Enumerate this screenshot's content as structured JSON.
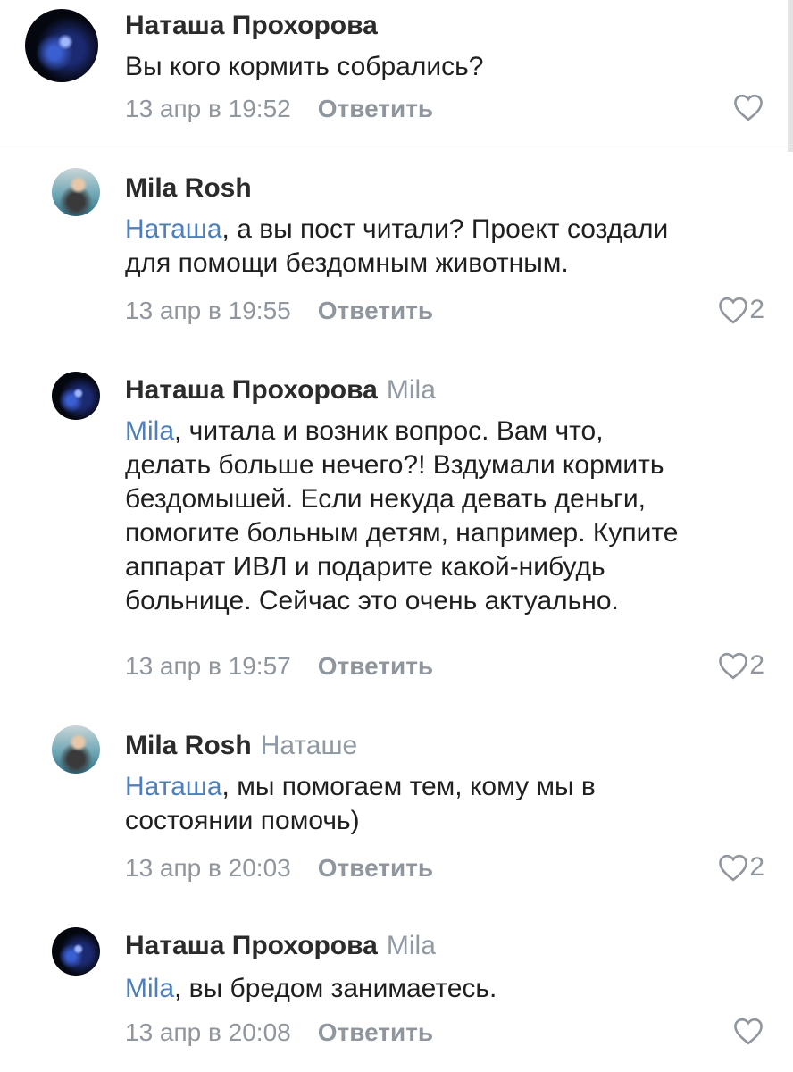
{
  "comments": [
    {
      "author": "Наташа Прохорова",
      "reply_to": "",
      "mention": "",
      "lines": [
        "Вы кого кормить собрались?"
      ],
      "date": "13 апр в 19:52",
      "reply_label": "Ответить",
      "likes": ""
    },
    {
      "author": "Mila Rosh",
      "reply_to": "",
      "mention": "Наташа",
      "lines": [
        ", а вы пост читали? Проект создали",
        "для помощи бездомным животным."
      ],
      "date": "13 апр в 19:55",
      "reply_label": "Ответить",
      "likes": "2"
    },
    {
      "author": "Наташа Прохорова",
      "reply_to": "Mila",
      "mention": "Mila",
      "lines": [
        ", читала и возник вопрос. Вам что,",
        "делать больше нечего?! Вздумали кормить",
        "бездомышей. Если некуда девать деньги,",
        "помогите больным детям, например. Купите",
        "аппарат ИВЛ и подарите какой-нибудь",
        "больнице. Сейчас это очень актуально."
      ],
      "date": "13 апр в 19:57",
      "reply_label": "Ответить",
      "likes": "2"
    },
    {
      "author": "Mila Rosh",
      "reply_to": "Наташе",
      "mention": "Наташа",
      "lines": [
        ", мы помогаем тем, кому мы в",
        "состоянии помочь)"
      ],
      "date": "13 апр в 20:03",
      "reply_label": "Ответить",
      "likes": "2"
    },
    {
      "author": "Наташа Прохорова",
      "reply_to": "Mila",
      "mention": "Mila",
      "lines": [
        ", вы бредом занимаетесь."
      ],
      "date": "13 апр в 20:08",
      "reply_label": "Ответить",
      "likes": ""
    }
  ],
  "colors": {
    "mention": "#4f7fb8",
    "meta": "#8f969e"
  },
  "icons": {
    "like": "heart-icon"
  }
}
